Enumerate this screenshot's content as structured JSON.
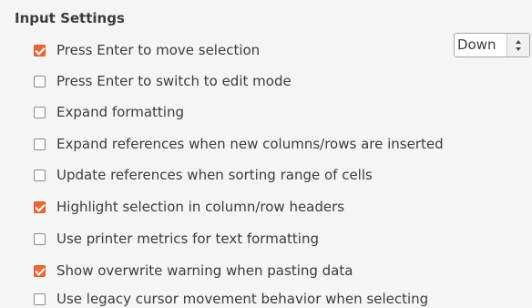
{
  "section": {
    "title": "Input Settings"
  },
  "options": [
    {
      "label": "Press Enter to move selection",
      "checked": true
    },
    {
      "label": "Press Enter to switch to edit mode",
      "checked": false
    },
    {
      "label": "Expand formatting",
      "checked": false
    },
    {
      "label": "Expand references when new columns/rows are inserted",
      "checked": false
    },
    {
      "label": "Update references when sorting range of cells",
      "checked": false
    },
    {
      "label": "Highlight selection in column/row headers",
      "checked": true
    },
    {
      "label": "Use printer metrics for text formatting",
      "checked": false
    },
    {
      "label": "Show overwrite warning when pasting data",
      "checked": true
    },
    {
      "label": "Use legacy cursor movement behavior when selecting",
      "checked": false
    }
  ],
  "direction": {
    "value": "Down"
  },
  "colors": {
    "accent": "#e96b3b",
    "background": "#f5f5f4",
    "text": "#3c3c3c"
  }
}
